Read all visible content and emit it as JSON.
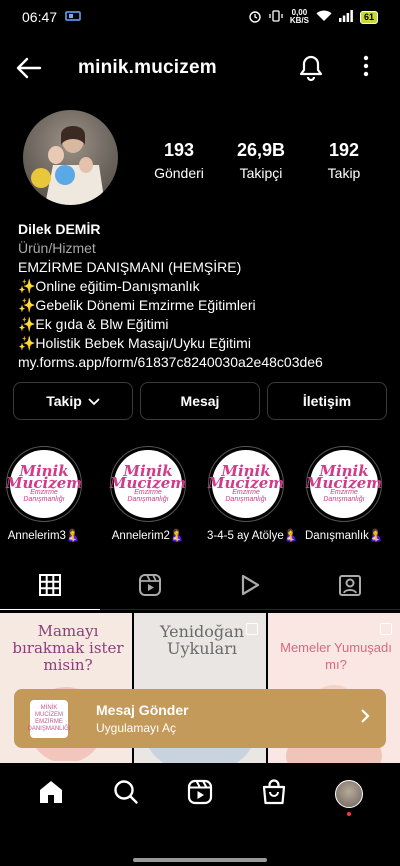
{
  "status_bar": {
    "time": "06:47",
    "net_speed_value": "0,00",
    "net_speed_unit": "KB/S",
    "battery": "61"
  },
  "header": {
    "username": "minik.mucizem"
  },
  "stats": [
    {
      "value": "193",
      "label": "Gönderi"
    },
    {
      "value": "26,9B",
      "label": "Takipçi"
    },
    {
      "value": "192",
      "label": "Takip"
    }
  ],
  "bio": {
    "name": "Dilek DEMİR",
    "category": "Ürün/Hizmet",
    "lines": [
      "EMZİRME DANIŞMANI (HEMŞİRE)",
      "✨Online eğitim-Danışmanlık",
      "✨Gebelik Dönemi Emzirme Eğitimleri",
      "✨Ek gıda & Blw Eğitimi",
      "✨Holistik Bebek Masajı/Uyku Eğitimi"
    ],
    "link": "my.forms.app/form/61837c8240030a2e48c03de6"
  },
  "buttons": {
    "follow": "Takip",
    "message": "Mesaj",
    "contact": "İletişim"
  },
  "highlights": [
    {
      "label": "Annelerim3🤱",
      "logo_top": "Minik",
      "logo_mid": "Mucizem",
      "logo_sub": "Emzirme Danışmanlığı"
    },
    {
      "label": "Annelerim2🤱",
      "logo_top": "Minik",
      "logo_mid": "Mucizem",
      "logo_sub": "Emzirme Danışmanlığı"
    },
    {
      "label": "3-4-5 ay Atölye🤱",
      "logo_top": "Minik",
      "logo_mid": "Mucizem",
      "logo_sub": "Emzirme Danışmanlığı"
    },
    {
      "label": "Danışmanlık🤱",
      "logo_top": "Minik",
      "logo_mid": "Mucizem",
      "logo_sub": "Emzirme Danışmanlığı"
    }
  ],
  "posts": [
    {
      "text": "Mamayı bırakmak ister misin?"
    },
    {
      "text": "Yenidoğan Uykuları"
    },
    {
      "text": "Memeler Yumuşadı mı?"
    }
  ],
  "banner": {
    "title": "Mesaj Gönder",
    "subtitle": "Uygulamayı Aç",
    "thumb_text": "MİNİK MUCİZEM EMZİRME DANIŞMANLIĞI"
  },
  "colors": {
    "background": "#000000",
    "banner": "#c49a5a",
    "notification_dot": "#ff3040",
    "logo_pink": "#d03b8a"
  }
}
